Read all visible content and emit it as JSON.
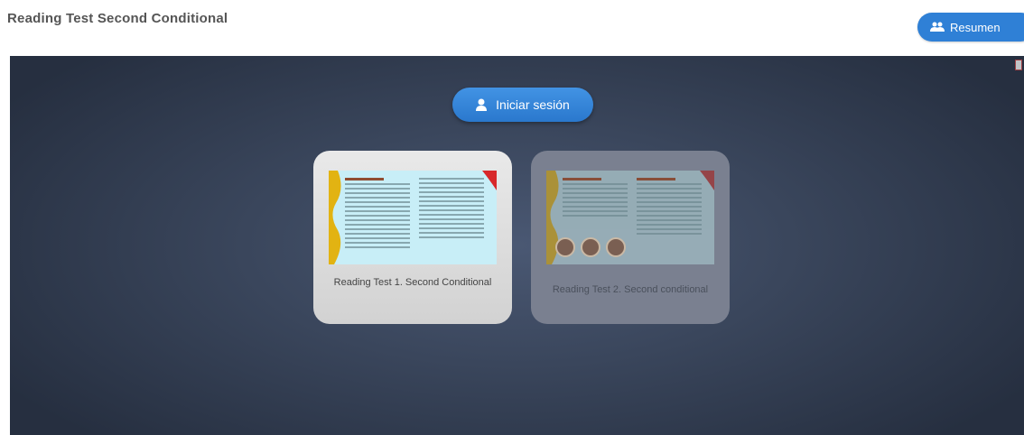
{
  "header": {
    "title": "Reading Test Second Conditional",
    "summary_button": "Resumen"
  },
  "stage": {
    "login_button": "Iniciar sesión",
    "cards": [
      {
        "label": "Reading Test 1. Second Conditional"
      },
      {
        "label": "Reading Test 2. Second conditional"
      }
    ]
  },
  "colors": {
    "accent": "#2f80d6",
    "stage_bg": "#3a465c",
    "card_active": "#dcdcdc",
    "card_inactive": "#7a8090"
  },
  "icons": {
    "summary": "users-icon",
    "login": "user-icon"
  }
}
